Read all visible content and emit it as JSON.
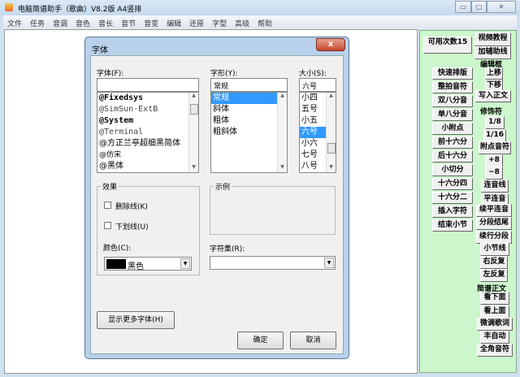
{
  "window": {
    "title": "电脑简谱助手（歌曲）V8.2版    A4竖排",
    "minimize": "▭",
    "maximize": "□",
    "close": "✕"
  },
  "menu": [
    "文件",
    "任务",
    "音调",
    "音色",
    "音长",
    "音节",
    "音变",
    "编辑",
    "还原",
    "字型",
    "高级",
    "帮助"
  ],
  "panel": {
    "count_button": "可用次数15",
    "video_tutorial": "视频教程",
    "add_guides": "加辅助线",
    "edit_box_label": "编辑框",
    "move_up": "上移",
    "move_down": "下移",
    "write_body": "写入正文",
    "decorator_label": "修饰符",
    "eighth": "1/8",
    "sixteenth": "1/16",
    "dotted_note": "附点音符",
    "plus8": "+8",
    "minus8": "−8",
    "tie": "连音线",
    "flat_tie": "平连音",
    "cont_flat_tie": "续平连音",
    "section_end": "分段结尾",
    "cont_section": "续行分段",
    "barline": "小节线",
    "right_repeat": "右反复",
    "left_repeat": "左反复",
    "score_body_label": "简谱正文",
    "see_below": "看下面",
    "see_above": "看上面",
    "fine_tune_lyrics": "微调歌词",
    "auto": "丰自动",
    "fullwidth_notes": "全角音符",
    "left_buttons": [
      "快速排版",
      "整拍音符",
      "双八分音",
      "单八分音",
      "小附点",
      "前十六分",
      "后十六分",
      "小切分",
      "十六分四",
      "十六分二",
      "插入字符",
      "结束小节"
    ]
  },
  "dialog": {
    "title": "字体",
    "close": "x",
    "font_label": "字体(F):",
    "font_value": "",
    "fonts": [
      "@Fixedsys",
      "@SimSun-ExtB",
      "@System",
      "@Terminal",
      "@方正兰亭超细黑简体",
      "@仿宋",
      "@黑体"
    ],
    "style_label": "字形(Y):",
    "style_value": "常规",
    "styles": [
      "常规",
      "斜体",
      "粗体",
      "粗斜体"
    ],
    "style_selected": "常规",
    "size_label": "大小(S):",
    "size_value": "六号",
    "sizes": [
      "小四",
      "五号",
      "小五",
      "六号",
      "小六",
      "七号",
      "八号"
    ],
    "size_selected": "六号",
    "effects_label": "效果",
    "strikeout": "删除线(K)",
    "underline": "下划线(U)",
    "strikeout_checked": false,
    "underline_checked": false,
    "color_label": "颜色(C):",
    "color_value": "黑色",
    "color_swatch": "#000000",
    "sample_label": "示例",
    "charset_label": "字符集(R):",
    "charset_value": "",
    "more_fonts": "显示更多字体(H)",
    "ok": "确定",
    "cancel": "取消"
  }
}
